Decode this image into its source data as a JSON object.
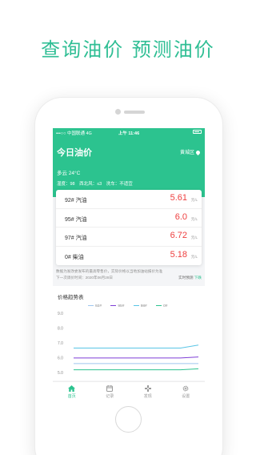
{
  "banner": {
    "title": "查询油价  预测油价"
  },
  "status_bar": {
    "carrier": "•••○○ 中国联通  4G",
    "time": "上午 11:46",
    "battery_icon": "battery-icon"
  },
  "header": {
    "title": "今日油价",
    "location": "黄城区",
    "weather": "多云  24°C",
    "humidity": "湿度：98",
    "wind": "西北风：≤3",
    "car_wash": "洗车：不适宜"
  },
  "prices": [
    {
      "name": "92# 汽油",
      "value": "5.61",
      "unit": "元/L"
    },
    {
      "name": "95# 汽油",
      "value": "6.0",
      "unit": "元/L"
    },
    {
      "name": "97# 汽油",
      "value": "6.72",
      "unit": "元/L"
    },
    {
      "name": "0# 柴油",
      "value": "5.18",
      "unit": "元/L"
    }
  ],
  "note": {
    "line1": "数据为发改委发布的最高零售价，实际价格以当地加油站报价为准",
    "line2": "下一次调价时间：2020年06月28日",
    "more_prefix": "实时预测",
    "more_link": "下跌"
  },
  "trend": {
    "title": "价格趋势表"
  },
  "chart_data": {
    "type": "line",
    "title": "价格趋势表",
    "ylim": [
      5.0,
      9.0
    ],
    "yticks": [
      "9.0",
      "8.0",
      "7.0",
      "6.0",
      "5.0"
    ],
    "x": [
      0,
      1,
      2,
      3,
      4,
      5,
      6,
      7
    ],
    "series": [
      {
        "name": "92#",
        "color": "#9fc6ee",
        "values": [
          5.6,
          5.6,
          5.6,
          5.6,
          5.6,
          5.6,
          5.6,
          5.6
        ]
      },
      {
        "name": "95#",
        "color": "#7f3fd6",
        "values": [
          5.98,
          5.98,
          5.98,
          5.98,
          5.98,
          5.98,
          5.98,
          6.05
        ]
      },
      {
        "name": "98#",
        "color": "#59c5e6",
        "values": [
          6.65,
          6.65,
          6.65,
          6.65,
          6.65,
          6.65,
          6.65,
          6.85
        ]
      },
      {
        "name": "0#",
        "color": "#2cc38f",
        "values": [
          5.18,
          5.18,
          5.18,
          5.18,
          5.18,
          5.18,
          5.18,
          5.25
        ]
      }
    ]
  },
  "tabs": [
    {
      "label": "首页",
      "icon": "home-icon",
      "active": true
    },
    {
      "label": "记录",
      "icon": "calendar-icon",
      "active": false
    },
    {
      "label": "发现",
      "icon": "gamepad-icon",
      "active": false
    },
    {
      "label": "设置",
      "icon": "gear-icon",
      "active": false
    }
  ],
  "colors": {
    "brand": "#2cc38f",
    "price": "#ee3f3f"
  }
}
